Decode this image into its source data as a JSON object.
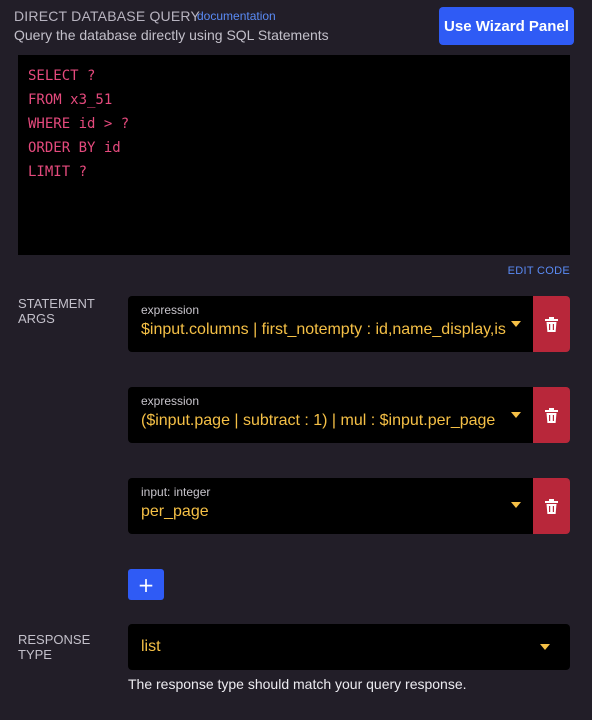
{
  "header": {
    "title": "DIRECT DATABASE QUERY",
    "doc_link": "documentation",
    "subtitle": "Query the database directly using SQL Statements",
    "wizard_button": "Use Wizard Panel"
  },
  "code": {
    "lines": [
      "SELECT ?",
      "FROM x3_51",
      "WHERE id > ?",
      "ORDER BY id",
      "LIMIT ?"
    ],
    "edit_label": "EDIT CODE"
  },
  "statement_args": {
    "label": "STATEMENT ARGS",
    "items": [
      {
        "type": "expression",
        "value": "$input.columns | first_notempty : id,name_display,is"
      },
      {
        "type": "expression",
        "value": "($input.page | subtract : 1) | mul : $input.per_page"
      },
      {
        "type": "input: integer",
        "value": "per_page"
      }
    ],
    "add_label": "+"
  },
  "response": {
    "label": "RESPONSE TYPE",
    "value": "list",
    "note": "The response type should match your query response."
  },
  "colors": {
    "background": "#221e28",
    "accent": "#2f5bf5",
    "danger": "#b8273a",
    "value_text": "#f5c046",
    "sql_text": "#e54a7d"
  },
  "icons": {
    "delete": "trash-icon",
    "dropdown": "chevron-down-icon"
  }
}
